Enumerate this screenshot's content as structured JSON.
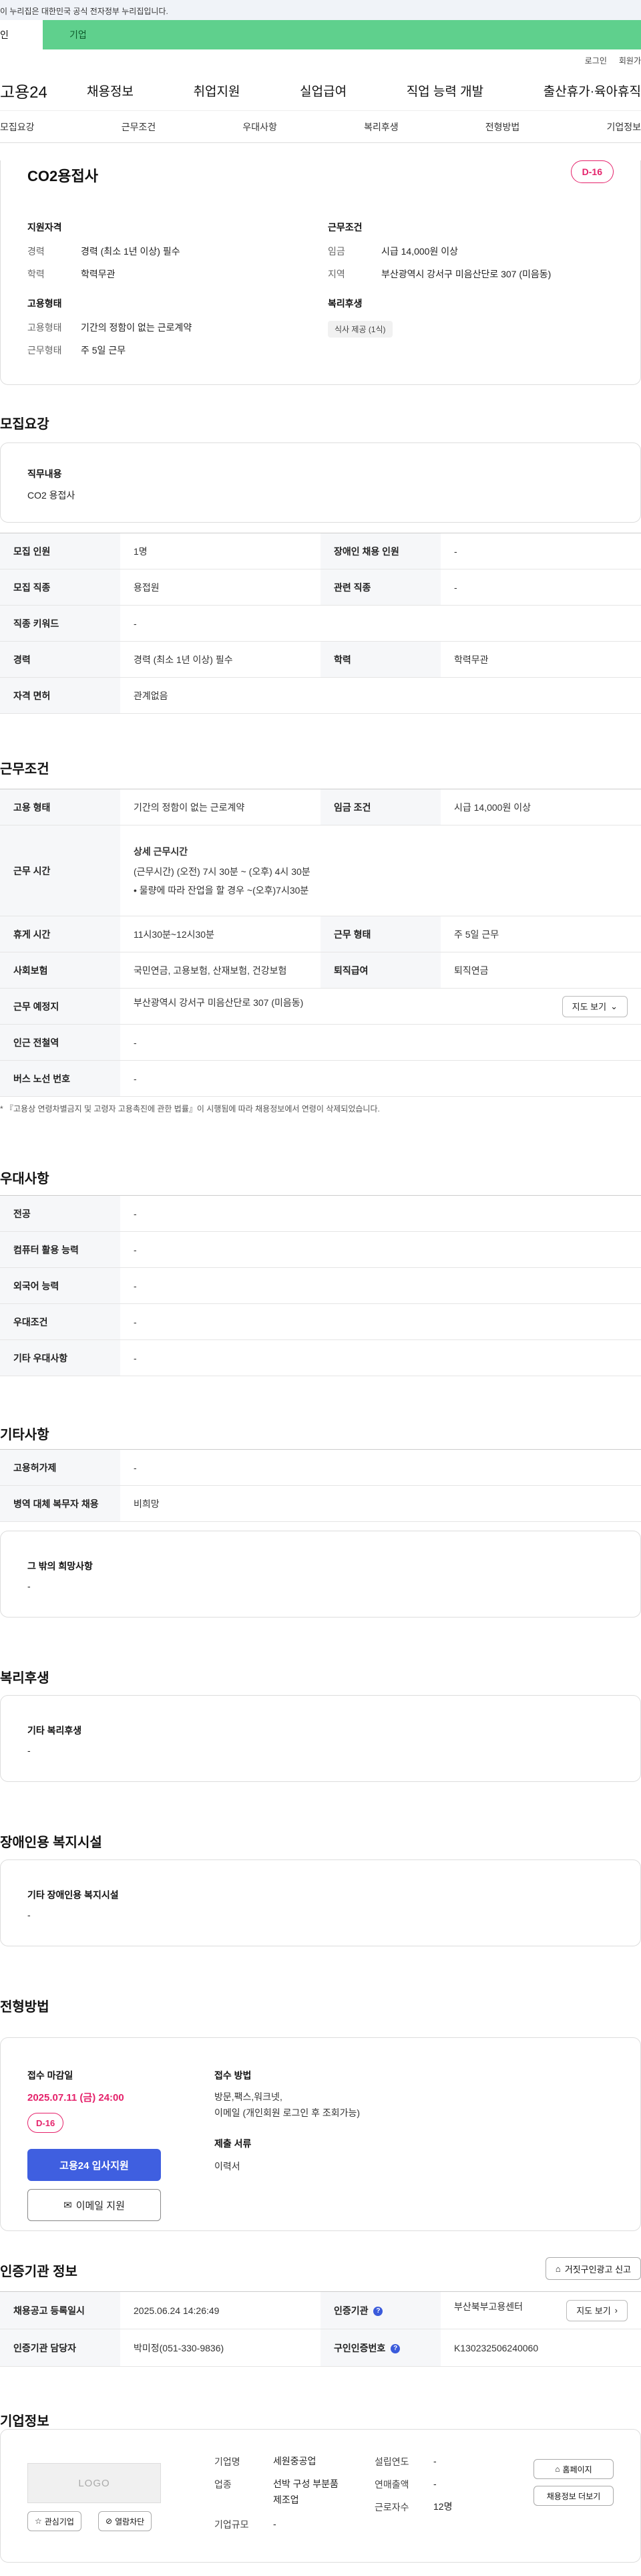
{
  "gov_banner": "이 누리집은 대한민국 공식 전자정부 누리집입니다.",
  "top_tabs": [
    "인",
    "기업"
  ],
  "util_links": [
    "로그인",
    "회원가"
  ],
  "gnb": {
    "logo": "고용24",
    "menu": [
      "채용정보",
      "취업지원",
      "실업급여",
      "직업 능력 개발",
      "출산휴가·육아휴직"
    ]
  },
  "anchors": [
    "모집요강",
    "근무조건",
    "우대사항",
    "복리후생",
    "전형방법",
    "기업정보"
  ],
  "summary": {
    "title": "CO2용접사",
    "dday": "D-16",
    "qual_title": "지원자격",
    "qual": [
      {
        "k": "경력",
        "v": "경력 (최소 1년 이상) 필수"
      },
      {
        "k": "학력",
        "v": "학력무관"
      }
    ],
    "work_title": "근무조건",
    "work": [
      {
        "k": "임금",
        "v": "시급 14,000원 이상"
      },
      {
        "k": "지역",
        "v": "부산광역시 강서구 미음산단로 307 (미음동)"
      }
    ],
    "emp_title": "고용형태",
    "emp": [
      {
        "k": "고용형태",
        "v": "기간의 정함이 없는 근로계약"
      },
      {
        "k": "근무형태",
        "v": "주 5일 근무"
      }
    ],
    "welfare_title": "복리후생",
    "welfare_chip": "식사 제공 (1식)"
  },
  "recruit": {
    "heading": "모집요강",
    "job_title": "직무내용",
    "job_value": "CO2 용접사",
    "rows": [
      {
        "k1": "모집 인원",
        "v1": "1명",
        "k2": "장애인 채용 인원",
        "v2": "-"
      },
      {
        "k1": "모집 직종",
        "v1": "용접원",
        "k2": "관련 직종",
        "v2": "-"
      },
      {
        "k1": "직종 키워드",
        "v1": "-"
      },
      {
        "k1": "경력",
        "v1": "경력 (최소 1년 이상) 필수",
        "k2": "학력",
        "v2": "학력무관"
      },
      {
        "k1": "자격 면허",
        "v1": "관계없음"
      }
    ]
  },
  "conditions": {
    "heading": "근무조건",
    "emp_type_k": "고용 형태",
    "emp_type_v": "기간의 정함이 없는 근로계약",
    "wage_k": "임금 조건",
    "wage_v": "시급 14,000원 이상",
    "hours_k": "근무 시간",
    "hours_title": "상세 근무시간",
    "hours_l1": "(근무시간) (오전) 7시 30분 ~ (오후) 4시 30분",
    "hours_l2": "• 물량에 따라 잔업을 할 경우 ~(오후)7시30분",
    "break_k": "휴게 시간",
    "break_v": "11시30분~12시30분",
    "form_k": "근무 형태",
    "form_v": "주 5일 근무",
    "ins_k": "사회보험",
    "ins_v": "국민연금, 고용보험, 산재보험, 건강보험",
    "ret_k": "퇴직급여",
    "ret_v": "퇴직연금",
    "loc_k": "근무 예정지",
    "loc_v": "부산광역시 강서구 미음산단로 307 (미음동)",
    "map_btn": "지도 보기",
    "subway_k": "인근 전철역",
    "subway_v": "-",
    "bus_k": "버스 노선 번호",
    "bus_v": "-",
    "note": "* 『고용상 연령차별금지 및 고령자 고용촉진에 관한 법률』이 시행됨에 따라 채용정보에서 연령이 삭제되었습니다."
  },
  "preference": {
    "heading": "우대사항",
    "rows": [
      {
        "k": "전공",
        "v": "-"
      },
      {
        "k": "컴퓨터 활용 능력",
        "v": "-"
      },
      {
        "k": "외국어 능력",
        "v": "-"
      },
      {
        "k": "우대조건",
        "v": "-"
      },
      {
        "k": "기타 우대사항",
        "v": "-"
      }
    ]
  },
  "etc": {
    "heading": "기타사항",
    "rows": [
      {
        "k": "고용허가제",
        "v": "-"
      },
      {
        "k": "병역 대체 복무자 채용",
        "v": "비희망"
      }
    ],
    "hope_title": "그 밖의 희망사항",
    "hope_value": "-"
  },
  "welfare": {
    "heading": "복리후생",
    "title": "기타 복리후생",
    "value": "-"
  },
  "disability": {
    "heading": "장애인용 복지시설",
    "title": "기타 장애인용 복지시설",
    "value": "-"
  },
  "selection": {
    "heading": "전형방법",
    "deadline_label": "접수 마감일",
    "deadline": "2025.07.11 (금) 24:00",
    "dday": "D-16",
    "apply_btn": "고용24 입사지원",
    "email_btn": "이메일 지원",
    "method_label": "접수 방법",
    "method_l1": "방문,팩스,워크넷,",
    "method_l2": "이메일 (개인회원 로그인 후 조회가능)",
    "docs_label": "제출 서류",
    "docs_value": "이력서"
  },
  "agency": {
    "heading": "인증기관 정보",
    "report_btn": "거짓구인광고 신고",
    "reg_k": "채용공고 등록일시",
    "reg_v": "2025.06.24 14:26:49",
    "org_k": "인증기관",
    "org_v": "부산북부고용센터",
    "map_btn": "지도 보기",
    "mgr_k": "인증기관 담당자",
    "mgr_v": "박미정(051-330-9836)",
    "no_k": "구인인증번호",
    "no_v": "K130232506240060"
  },
  "company": {
    "heading": "기업정보",
    "logo": "LOGO",
    "fav_btn": "관심기업",
    "block_btn": "열람차단",
    "name_k": "기업명",
    "name_v": "세원중공업",
    "industry_k": "업종",
    "industry_l1": "선박 구성 부분품",
    "industry_l2": "제조업",
    "size_k": "기업규모",
    "size_v": "-",
    "year_k": "설립연도",
    "year_v": "-",
    "sales_k": "연매출액",
    "sales_v": "-",
    "staff_k": "근로자수",
    "staff_v": "12명",
    "home_btn": "홈페이지",
    "jobs_btn": "채용정보 더보기"
  }
}
